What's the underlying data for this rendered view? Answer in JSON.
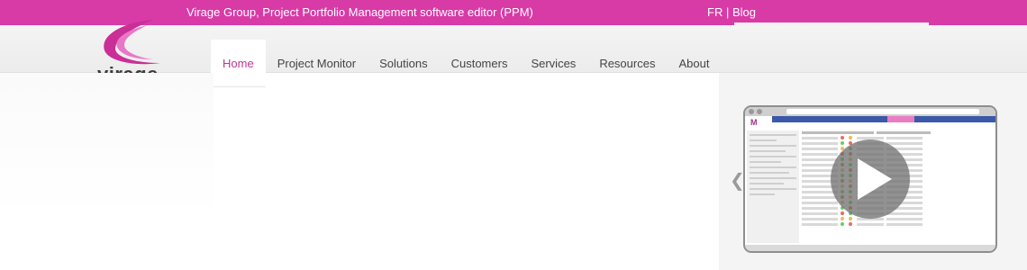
{
  "header": {
    "tagline": "Virage Group, Project Portfolio Management software editor (PPM)",
    "lang_link": "FR",
    "separator": "|",
    "blog_link": "Blog"
  },
  "logo": {
    "text": "virage",
    "icon": "virage-swoosh-logo"
  },
  "nav": {
    "items": [
      {
        "label": "Home",
        "active": true
      },
      {
        "label": "Project Monitor",
        "active": false
      },
      {
        "label": "Solutions",
        "active": false
      },
      {
        "label": "Customers",
        "active": false
      },
      {
        "label": "Services",
        "active": false
      },
      {
        "label": "Resources",
        "active": false
      },
      {
        "label": "About",
        "active": false
      }
    ]
  },
  "carousel": {
    "prev_icon": "chevron-left-icon",
    "video_thumbnail": {
      "play_icon": "play-icon",
      "app_logo": "M"
    }
  },
  "colors": {
    "brand": "#d83aa6",
    "active_nav": "#c0358e"
  }
}
